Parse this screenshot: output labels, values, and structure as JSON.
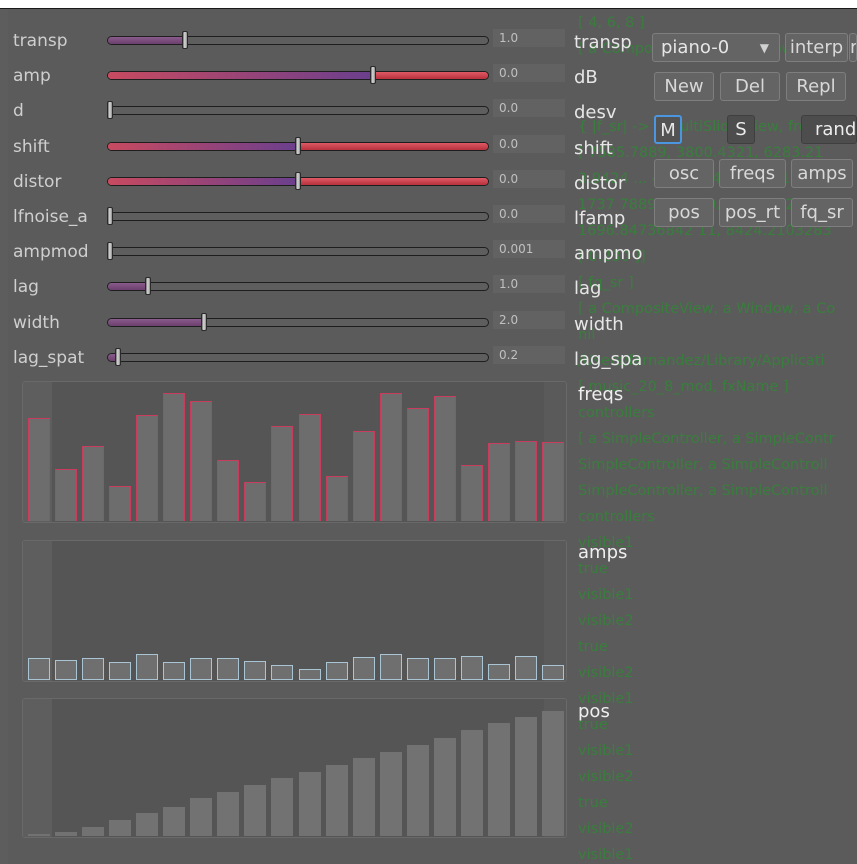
{
  "background_text": [
    "[ 4, 6, 8 ]",
    "[ a CompositeView, a Window, a Ve",
    "",
    "",
    "{ |f_sr| -> a MultiSliderView, freqs",
    "[ 7585.7889, 3800.4321, 6283.21",
    "3.9424 ... 4418.3742, 2288.12",
    "1737 7889 ... 3800.4321, 8424.21",
    "1696.84736842 11, 8424.2103283",
    "[ 0.230 ]]",
    "[ fq_sr ]",
    "[ a CompositeView, a Window, a Co",
    "nil",
    "/Users/fernandez/Library/Applicati",
    "[ music_20_8_mod, fxName ]",
    "controllers",
    "[ a SimpleController, a SimpleContr",
    "SimpleController, a SimpleControll",
    "SimpleController, a SimpleControll",
    "controllers",
    "visible1",
    "true",
    "visible1",
    "visible2",
    "true",
    "visible2",
    "visible1",
    "true",
    "visible1",
    "visible2",
    "true",
    "visible2",
    "visible1"
  ],
  "sliders": [
    {
      "label": "transp",
      "value": "1.0",
      "right_label": "transp",
      "fraction": 0.2,
      "style": "purple"
    },
    {
      "label": "amp",
      "value": "0.0",
      "right_label": "dB",
      "fraction": 0.7,
      "style": "gradient"
    },
    {
      "label": "d",
      "value": "0.0",
      "right_label": "desv",
      "fraction": 0.0,
      "style": "none"
    },
    {
      "label": "shift",
      "value": "0.0",
      "right_label": "shift",
      "fraction": 0.5,
      "style": "gradient"
    },
    {
      "label": "distor",
      "value": "0.0",
      "right_label": "distor",
      "fraction": 0.5,
      "style": "gradient"
    },
    {
      "label": "lfnoise_a",
      "value": "0.0",
      "right_label": "lfamp",
      "fraction": 0.0,
      "style": "none"
    },
    {
      "label": "ampmod",
      "value": "0.001",
      "right_label": "ampmo",
      "fraction": 0.0,
      "style": "none"
    },
    {
      "label": "lag",
      "value": "1.0",
      "right_label": "lag",
      "fraction": 0.1,
      "style": "purple"
    },
    {
      "label": "width",
      "value": "2.0",
      "right_label": "width",
      "fraction": 0.25,
      "style": "purple"
    },
    {
      "label": "lag_spat",
      "value": "0.2",
      "right_label": "lag_spa",
      "fraction": 0.02,
      "style": "purple"
    }
  ],
  "panels": {
    "freqs": {
      "label": "freqs",
      "values": [
        0.76,
        0.38,
        0.55,
        0.26,
        0.78,
        0.94,
        0.88,
        0.45,
        0.29,
        0.7,
        0.79,
        0.33,
        0.66,
        0.94,
        0.83,
        0.92,
        0.41,
        0.57,
        0.59,
        0.58
      ]
    },
    "amps": {
      "label": "amps",
      "values": [
        0.16,
        0.15,
        0.16,
        0.13,
        0.19,
        0.13,
        0.16,
        0.16,
        0.14,
        0.11,
        0.08,
        0.13,
        0.17,
        0.19,
        0.16,
        0.16,
        0.18,
        0.12,
        0.18,
        0.11
      ]
    },
    "pos": {
      "label": "pos",
      "values": [
        0.0,
        0.03,
        0.07,
        0.12,
        0.17,
        0.22,
        0.28,
        0.33,
        0.38,
        0.43,
        0.48,
        0.53,
        0.58,
        0.63,
        0.68,
        0.73,
        0.79,
        0.84,
        0.89,
        0.93
      ]
    }
  },
  "controls": {
    "preset": "piano-0",
    "interp": "interp",
    "cut_button": "r",
    "new": "New",
    "del": "Del",
    "repl": "Repl",
    "mute": "M",
    "solo": "S",
    "rand": "rand",
    "osc": "osc",
    "freqs": "freqs",
    "amps": "amps",
    "pos": "pos",
    "pos_rt": "pos_rt",
    "fq_sr": "fq_sr"
  },
  "colors": {
    "accent_blue": "#4a96e0",
    "slider_purple": "#7a4a7e",
    "slider_red": "#e05a66",
    "freqs_bar_border": "#c83c5e",
    "amps_bar_border": "#a9c4d2",
    "bg_text": "#2e8a34"
  }
}
